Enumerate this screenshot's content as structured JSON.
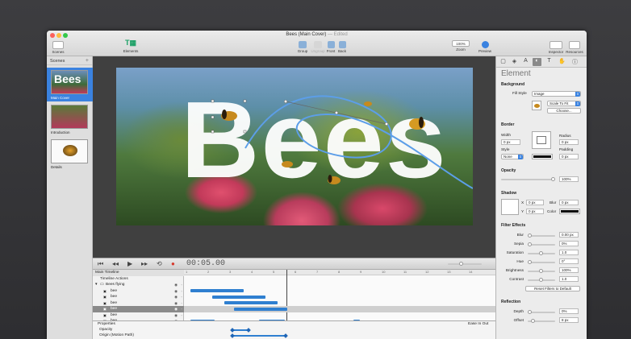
{
  "window": {
    "title": "Bees (Main Cover)",
    "edited": "— Edited"
  },
  "toolbar": {
    "scenes": "Scenes",
    "elements": "Elements",
    "group": "Group",
    "ungroup": "Ungroup",
    "front": "Front",
    "back": "Back",
    "zoom_value": "100%",
    "zoom": "Zoom",
    "preview": "Preview",
    "inspector": "Inspector",
    "resources": "Resources"
  },
  "scenes": {
    "header": "Scenes",
    "add": "+",
    "items": [
      {
        "label": "Main Cover",
        "thumb_text": "Bees"
      },
      {
        "label": "Introduction"
      },
      {
        "label": "Details"
      }
    ]
  },
  "canvas": {
    "headline": "Bees"
  },
  "timeline": {
    "timecode": "00:05.00",
    "ruler": [
      "1",
      "2",
      "3",
      "4",
      "5",
      "6",
      "7",
      "8",
      "9",
      "10",
      "11",
      "12",
      "13",
      "14"
    ],
    "rows": [
      {
        "label": "Main Timeline"
      },
      {
        "label": "Timeline Actions"
      },
      {
        "label": "Bees flying"
      },
      {
        "label": "bee"
      },
      {
        "label": "bee"
      },
      {
        "label": "bee"
      },
      {
        "label": "bee"
      },
      {
        "label": "bee"
      },
      {
        "label": "bee"
      },
      {
        "label": "Bees"
      },
      {
        "label": "background"
      },
      {
        "label": "background-blur"
      }
    ],
    "properties": {
      "label": "Properties",
      "easing": "Ease In Out"
    },
    "props": [
      {
        "label": "Opacity"
      },
      {
        "label": "Origin (Motion Path)"
      }
    ]
  },
  "inspector": {
    "title": "Element",
    "background": "Background",
    "fill_style_label": "Fill Style",
    "fill_style": "Image",
    "scale": "Scale To Fit",
    "choose": "Choose...",
    "border": "Border",
    "width": "Width",
    "width_val": "0 px",
    "style": "Style",
    "style_val": "None",
    "radius": "Radius",
    "radius_val": "0 px",
    "padding": "Padding",
    "padding_val": "0 px",
    "opacity": "Opacity",
    "opacity_val": "100%",
    "shadow": "Shadow",
    "x": "X",
    "x_val": "0 px",
    "y": "Y",
    "y_val": "0 px",
    "blur": "Blur",
    "blur_val": "0 px",
    "color": "Color",
    "filter": "Filter Effects",
    "filters": [
      {
        "label": "Blur",
        "value": "0.00 px"
      },
      {
        "label": "Sepia",
        "value": "0%"
      },
      {
        "label": "Saturation",
        "value": "1.0"
      },
      {
        "label": "Hue",
        "value": "0°"
      },
      {
        "label": "Brightness",
        "value": "100%"
      },
      {
        "label": "Contrast",
        "value": "1.0"
      }
    ],
    "reset": "Reset Filters to Default",
    "reflection": "Reflection",
    "depth": "Depth",
    "depth_val": "0%",
    "offset": "Offset",
    "offset_val": "8 px"
  },
  "colors": {
    "accent": "#2f7fd0",
    "selection": "#3a82e0"
  }
}
